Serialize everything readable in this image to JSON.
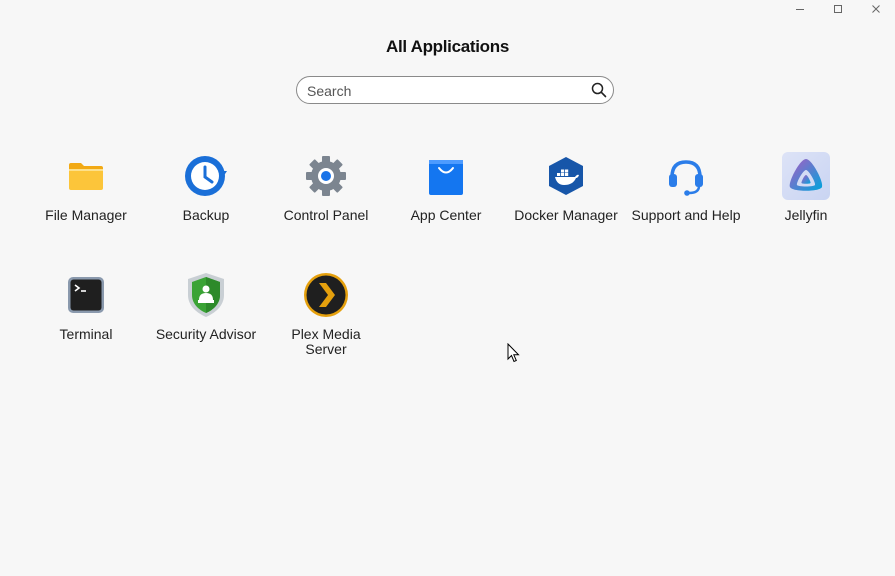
{
  "window": {
    "minimize_icon": "minimize-icon",
    "maximize_icon": "maximize-icon",
    "close_icon": "close-icon"
  },
  "header": {
    "title": "All Applications"
  },
  "search": {
    "placeholder": "Search",
    "value": "",
    "icon": "search-icon"
  },
  "apps": [
    {
      "label": "File Manager",
      "icon": "folder-icon",
      "color": "#f7b928"
    },
    {
      "label": "Backup",
      "icon": "backup-clock-icon",
      "color": "#1a6fd8"
    },
    {
      "label": "Control Panel",
      "icon": "gear-icon",
      "color": "#7c8590"
    },
    {
      "label": "App Center",
      "icon": "shopping-bag-icon",
      "color": "#1476f0"
    },
    {
      "label": "Docker Manager",
      "icon": "docker-whale-icon",
      "color": "#1756a9"
    },
    {
      "label": "Support and Help",
      "icon": "headset-icon",
      "color": "#2b7de9"
    },
    {
      "label": "Jellyfin",
      "icon": "jellyfin-triangle-icon",
      "color": "#aa5cc3"
    },
    {
      "label": "Terminal",
      "icon": "terminal-icon",
      "color": "#222222"
    },
    {
      "label": "Security Advisor",
      "icon": "security-shield-icon",
      "color": "#3aa335"
    },
    {
      "label": "Plex Media Server",
      "icon": "plex-chevron-icon",
      "color": "#e5a00d"
    }
  ]
}
